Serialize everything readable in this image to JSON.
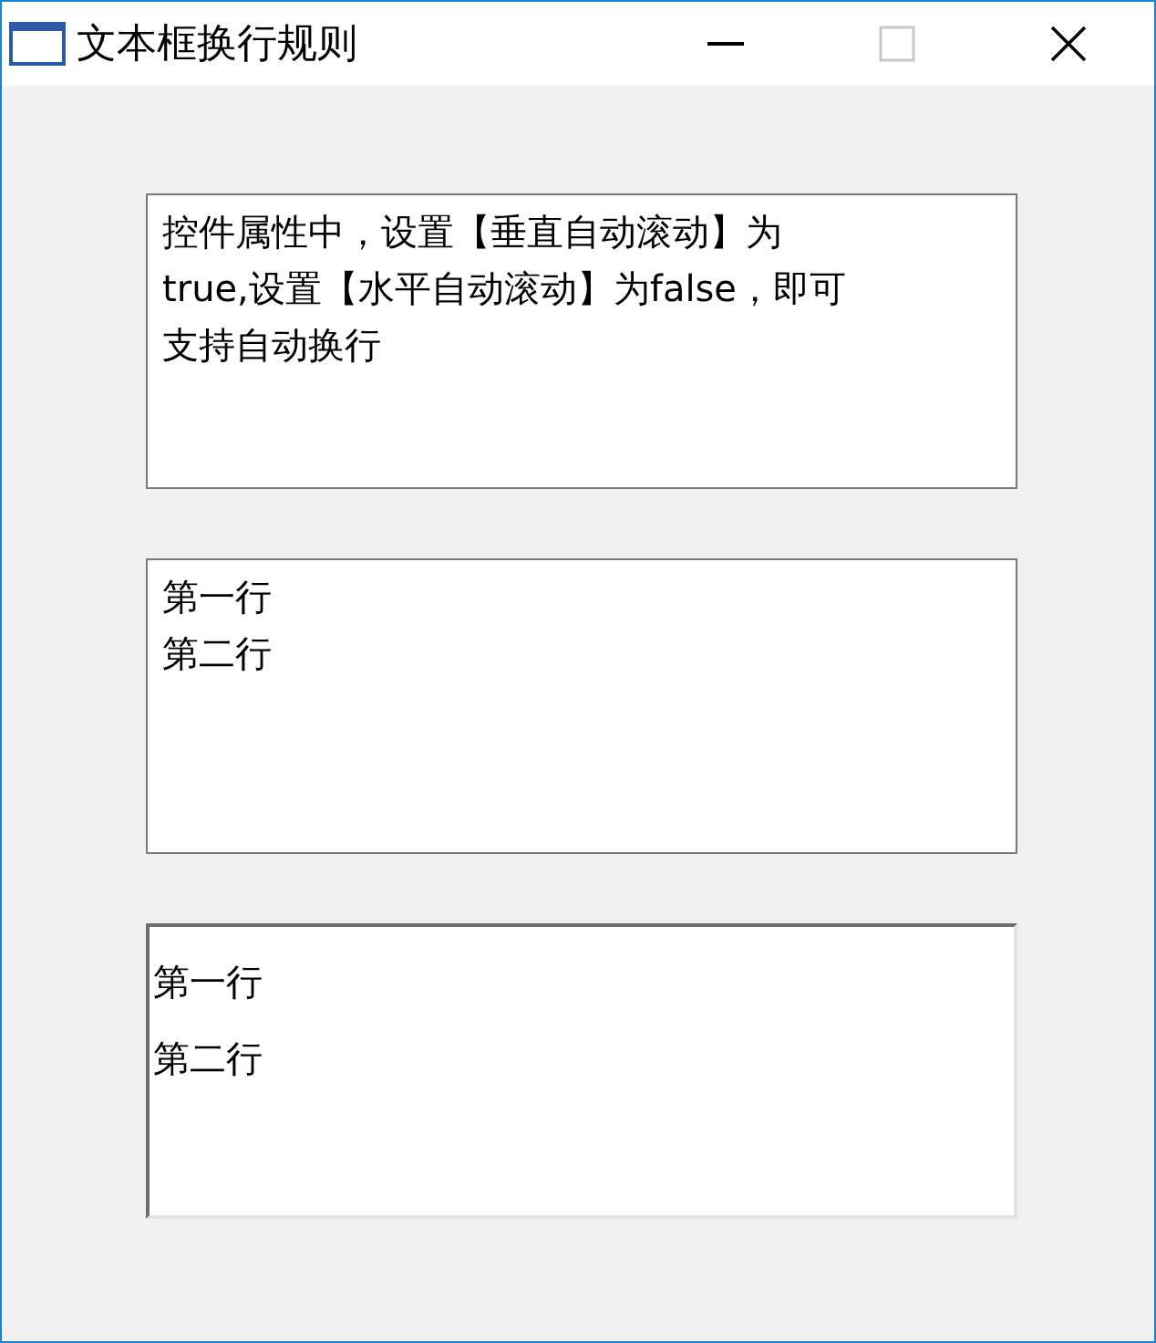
{
  "window": {
    "title": "文本框换行规则"
  },
  "text_boxes": [
    {
      "kind": "flat",
      "lines": [
        "控件属性中，设置【垂直自动滚动】为",
        "true,设置【水平自动滚动】为false，即可",
        "支持自动换行"
      ]
    },
    {
      "kind": "flat",
      "lines": [
        "第一行",
        "第二行"
      ]
    },
    {
      "kind": "sunken",
      "lines": [
        "第一行",
        "第二行"
      ]
    }
  ]
}
